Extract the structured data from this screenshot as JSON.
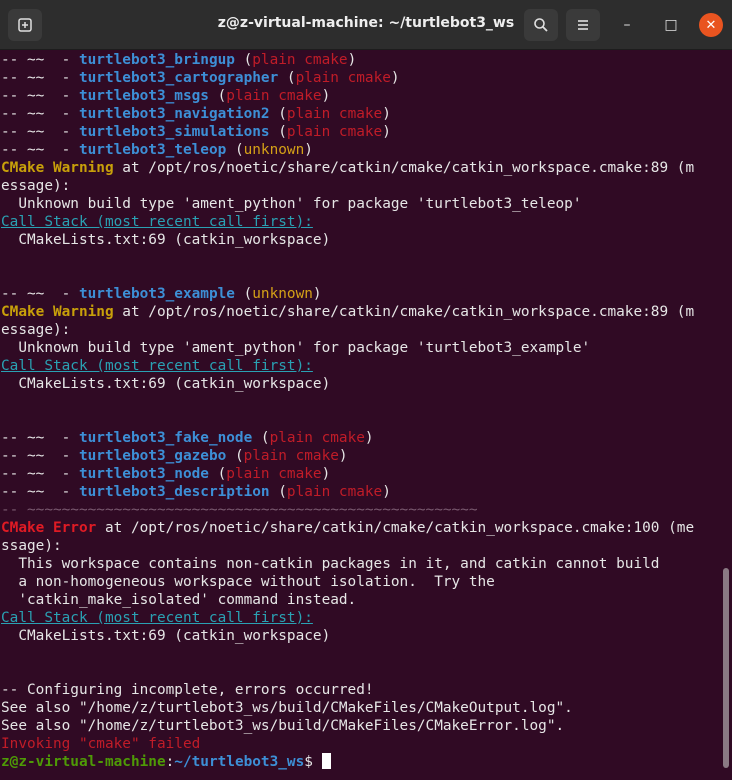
{
  "window": {
    "title": "z@z-virtual-machine: ~/turtlebot3_ws",
    "new_tab_icon": "new-tab-icon",
    "search_icon": "search-icon",
    "menu_icon": "hamburger-menu-icon",
    "minimize_glyph": "–",
    "maximize_glyph": "□",
    "close_glyph": "✕"
  },
  "pkgs_top": [
    {
      "name": "turtlebot3_bringup",
      "type": "plain cmake"
    },
    {
      "name": "turtlebot3_cartographer",
      "type": "plain cmake"
    },
    {
      "name": "turtlebot3_msgs",
      "type": "plain cmake"
    },
    {
      "name": "turtlebot3_navigation2",
      "type": "plain cmake"
    },
    {
      "name": "turtlebot3_simulations",
      "type": "plain cmake"
    },
    {
      "name": "turtlebot3_teleop",
      "type": "unknown"
    }
  ],
  "warn1": {
    "label": "CMake Warning",
    "rest": " at /opt/ros/noetic/share/catkin/cmake/catkin_workspace.cmake:89 (m",
    "cont": "essage):",
    "msg": "  Unknown build type 'ament_python' for package 'turtlebot3_teleop'",
    "callstack": "Call Stack (most recent call first):",
    "frame": "  CMakeLists.txt:69 (catkin_workspace)"
  },
  "pkg_example": {
    "name": "turtlebot3_example",
    "type": "unknown"
  },
  "warn2": {
    "label": "CMake Warning",
    "rest": " at /opt/ros/noetic/share/catkin/cmake/catkin_workspace.cmake:89 (m",
    "cont": "essage):",
    "msg": "  Unknown build type 'ament_python' for package 'turtlebot3_example'",
    "callstack": "Call Stack (most recent call first):",
    "frame": "  CMakeLists.txt:69 (catkin_workspace)"
  },
  "pkgs_bottom": [
    {
      "name": "turtlebot3_fake_node",
      "type": "plain cmake"
    },
    {
      "name": "turtlebot3_gazebo",
      "type": "plain cmake"
    },
    {
      "name": "turtlebot3_node",
      "type": "plain cmake"
    },
    {
      "name": "turtlebot3_description",
      "type": "plain cmake"
    }
  ],
  "prefix": "-- ~~  - ",
  "separator": "-- ~~~~~~~~~~~~~~~~~~~~~~~~~~~~~~~~~~~~~~~~~~~~~~~~~~~~",
  "error": {
    "label": "CMake Error",
    "rest": " at /opt/ros/noetic/share/catkin/cmake/catkin_workspace.cmake:100 (me",
    "cont": "ssage):",
    "msg1": "  This workspace contains non-catkin packages in it, and catkin cannot build",
    "msg2": "  a non-homogeneous workspace without isolation.  Try the",
    "msg3": "  'catkin_make_isolated' command instead.",
    "callstack": "Call Stack (most recent call first):",
    "frame": "  CMakeLists.txt:69 (catkin_workspace)"
  },
  "footer": {
    "configuring": "-- Configuring incomplete, errors occurred!",
    "see1": "See also \"/home/z/turtlebot3_ws/build/CMakeFiles/CMakeOutput.log\".",
    "see2": "See also \"/home/z/turtlebot3_ws/build/CMakeFiles/CMakeError.log\".",
    "invoking": "Invoking \"cmake\" failed"
  },
  "prompt": {
    "user": "z@z-virtual-machine",
    "colon": ":",
    "path": "~/turtlebot3_ws",
    "symbol": "$ "
  }
}
